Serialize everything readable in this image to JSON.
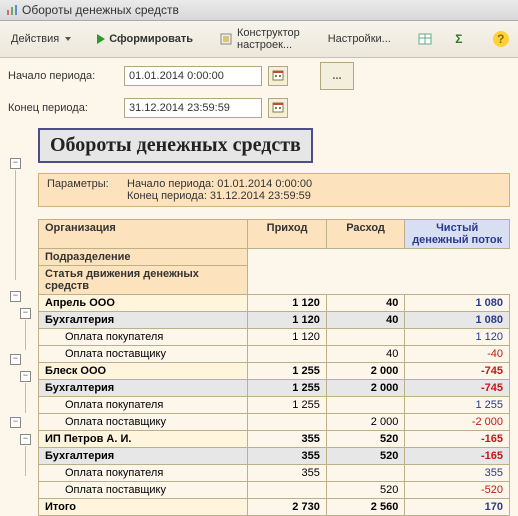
{
  "window_title": "Обороты денежных средств",
  "toolbar": {
    "actions": "Действия",
    "form": "Сформировать",
    "constructor": "Конструктор настроек...",
    "settings": "Настройки..."
  },
  "period": {
    "start_label": "Начало периода:",
    "start_value": "01.01.2014 0:00:00",
    "end_label": "Конец периода:",
    "end_value": "31.12.2014 23:59:59",
    "dots": "..."
  },
  "report": {
    "title": "Обороты денежных средств",
    "params_label": "Параметры:",
    "params_line1": "Начало периода: 01.01.2014 0:00:00",
    "params_line2": "Конец периода: 31.12.2014 23:59:59",
    "headers": {
      "org": "Организация",
      "dept": "Подразделение",
      "article": "Статья движения денежных средств",
      "in": "Приход",
      "out": "Расход",
      "net": "Чистый денежный поток"
    },
    "rows": [
      {
        "type": "org",
        "name": "Апрель ООО",
        "in": "1 120",
        "out": "40",
        "net": "1 080",
        "neg": false
      },
      {
        "type": "dept",
        "name": "Бухгалтерия",
        "in": "1 120",
        "out": "40",
        "net": "1 080",
        "neg": false
      },
      {
        "type": "art",
        "name": "Оплата покупателя",
        "in": "1 120",
        "out": "",
        "net": "1 120",
        "neg": false
      },
      {
        "type": "art",
        "name": "Оплата поставщику",
        "in": "",
        "out": "40",
        "net": "-40",
        "neg": true
      },
      {
        "type": "org",
        "name": "Блеск ООО",
        "in": "1 255",
        "out": "2 000",
        "net": "-745",
        "neg": true
      },
      {
        "type": "dept",
        "name": "Бухгалтерия",
        "in": "1 255",
        "out": "2 000",
        "net": "-745",
        "neg": true
      },
      {
        "type": "art",
        "name": "Оплата покупателя",
        "in": "1 255",
        "out": "",
        "net": "1 255",
        "neg": false
      },
      {
        "type": "art",
        "name": "Оплата поставщику",
        "in": "",
        "out": "2 000",
        "net": "-2 000",
        "neg": true
      },
      {
        "type": "org",
        "name": "ИП Петров А. И.",
        "in": "355",
        "out": "520",
        "net": "-165",
        "neg": true
      },
      {
        "type": "dept",
        "name": "Бухгалтерия",
        "in": "355",
        "out": "520",
        "net": "-165",
        "neg": true
      },
      {
        "type": "art",
        "name": "Оплата покупателя",
        "in": "355",
        "out": "",
        "net": "355",
        "neg": false
      },
      {
        "type": "art",
        "name": "Оплата поставщику",
        "in": "",
        "out": "520",
        "net": "-520",
        "neg": true
      },
      {
        "type": "total",
        "name": "Итого",
        "in": "2 730",
        "out": "2 560",
        "net": "170",
        "neg": false
      }
    ]
  }
}
